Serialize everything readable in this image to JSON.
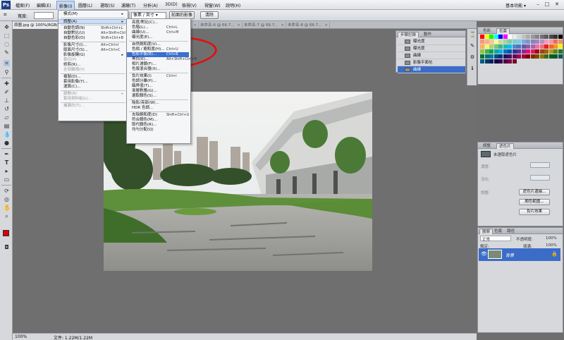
{
  "menubar": {
    "logo": "Ps",
    "items": [
      "檔案(F)",
      "編輯(E)",
      "影像(I)",
      "圖層(L)",
      "選取(S)",
      "濾鏡(T)",
      "分析(A)",
      "3D(D)",
      "檢視(V)",
      "視窗(W)",
      "說明(H)"
    ],
    "workspace": "基本功能 ▾",
    "minimize": "–",
    "restore": "□",
    "close": "✕"
  },
  "options": {
    "width_label": "寬度:",
    "width_value": "",
    "mode_select": "像素 / 英寸 ▾",
    "front_image_button": "前面的影像",
    "clear_button": "清除"
  },
  "tabs": [
    {
      "label": "原圖.jpg @ 100%(RGB/8)",
      "active": true
    },
    {
      "label": "未命名-3 @ 66.7...",
      "active": false
    },
    {
      "label": "未命名-5 @ 66.7...",
      "active": false
    },
    {
      "label": "未命名-4 @ 66.7...",
      "active": false
    },
    {
      "label": "未命名-6 @ 66.7...",
      "active": false
    },
    {
      "label": "未命名-7 @ 66.7...",
      "active": false
    },
    {
      "label": "未命名-8 @ 66.7...",
      "active": false
    }
  ],
  "image_menu": [
    {
      "label": "模式(M)",
      "arrow": "▸"
    },
    {
      "sep": true
    },
    {
      "label": "調整(A)",
      "arrow": "▸",
      "state": "sub"
    },
    {
      "sep": true
    },
    {
      "label": "自動色調(N)",
      "shortcut": "Shift+Ctrl+L"
    },
    {
      "label": "自動對比(U)",
      "shortcut": "Alt+Shift+Ctrl+L"
    },
    {
      "label": "自動色彩(O)",
      "shortcut": "Shift+Ctrl+B"
    },
    {
      "sep": true
    },
    {
      "label": "影像尺寸(I)...",
      "shortcut": "Alt+Ctrl+I"
    },
    {
      "label": "版面尺寸(S)...",
      "shortcut": "Alt+Ctrl+C"
    },
    {
      "label": "影像旋轉(G)",
      "arrow": "▸"
    },
    {
      "label": "裁切(P)",
      "state": "dis"
    },
    {
      "label": "修剪(R)..."
    },
    {
      "label": "全部顯現(V)",
      "state": "dis"
    },
    {
      "sep": true
    },
    {
      "label": "複製(D)..."
    },
    {
      "label": "套用影像(Y)..."
    },
    {
      "label": "運算(C)..."
    },
    {
      "sep": true
    },
    {
      "label": "變數(B)",
      "arrow": "▸",
      "state": "dis"
    },
    {
      "label": "套用資料組(L)...",
      "state": "dis"
    },
    {
      "sep": true
    },
    {
      "label": "補漏白(T)...",
      "state": "dis"
    }
  ],
  "adjust_menu": [
    {
      "label": "亮度/對比(C)..."
    },
    {
      "label": "色階(L)...",
      "shortcut": "Ctrl+L"
    },
    {
      "label": "曲線(U)...",
      "shortcut": "Ctrl+M"
    },
    {
      "label": "曝光度(E)..."
    },
    {
      "sep": true
    },
    {
      "label": "自然飽和度(V)..."
    },
    {
      "label": "色相 / 飽和度(H)...",
      "shortcut": "Ctrl+U"
    },
    {
      "label": "色彩平衡(B)...",
      "shortcut": "Ctrl+B",
      "state": "hl"
    },
    {
      "label": "黑白(K)...",
      "shortcut": "Alt+Shift+Ctrl+B"
    },
    {
      "label": "相片濾鏡(F)..."
    },
    {
      "label": "色版混合器(X)..."
    },
    {
      "sep": true
    },
    {
      "label": "負片效果(I)",
      "shortcut": "Ctrl+I"
    },
    {
      "label": "色調分離(P)..."
    },
    {
      "label": "臨界值(T)..."
    },
    {
      "label": "漸層對應(G)..."
    },
    {
      "label": "選取顏色(S)..."
    },
    {
      "sep": true
    },
    {
      "label": "陰影/亮部(W)..."
    },
    {
      "label": "HDR 色調..."
    },
    {
      "sep": true
    },
    {
      "label": "去除飽和度(D)",
      "shortcut": "Shift+Ctrl+U"
    },
    {
      "label": "符合顏色(M)..."
    },
    {
      "label": "取代顏色(R)..."
    },
    {
      "label": "均勻分配(Q)"
    }
  ],
  "history": {
    "tabs": [
      "步驟記錄",
      "動作"
    ],
    "items": [
      {
        "label": "曝光度",
        "selected": false
      },
      {
        "label": "曝光度",
        "selected": false
      },
      {
        "label": "曲線",
        "selected": false
      },
      {
        "label": "影像平面化",
        "selected": false
      },
      {
        "label": "曲線",
        "selected": true
      }
    ]
  },
  "color_panel": {
    "tabs": [
      "色彩",
      "色票"
    ],
    "swatch_colors": [
      "#ff0000",
      "#ffff00",
      "#00ff00",
      "#00ffff",
      "#0000ff",
      "#ff00ff",
      "#ffffff",
      "#ebebeb",
      "#d6d6d6",
      "#c2c2c2",
      "#adadad",
      "#999999",
      "#858585",
      "#707070",
      "#5c5c5c",
      "#474747",
      "#333333",
      "#000000",
      "#f7977a",
      "#fbad82",
      "#fdc68c",
      "#fff799",
      "#c6df9c",
      "#a4d49d",
      "#81ca9d",
      "#7bcdc8",
      "#6ecff6",
      "#7ea7d8",
      "#8493ca",
      "#8882be",
      "#a286bd",
      "#bc8cbf",
      "#f49bc1",
      "#f5999d",
      "#f26c4f",
      "#f68e56",
      "#fbaf5a",
      "#fff467",
      "#acd372",
      "#7cc576",
      "#3bb878",
      "#1abbb4",
      "#00bff3",
      "#438ccb",
      "#5574b9",
      "#605ca9",
      "#855fa8",
      "#a763a9",
      "#ef6ea8",
      "#f16d7e",
      "#ed1c24",
      "#f26522",
      "#f7941d",
      "#fff200",
      "#8dc63f",
      "#39b54a",
      "#00a651",
      "#00a99d",
      "#00aeef",
      "#0072bc",
      "#0054a6",
      "#2e3192",
      "#662d91",
      "#92278f",
      "#ec008c",
      "#ed145b",
      "#9e0b0f",
      "#a0410d",
      "#a3620a",
      "#aba000",
      "#598527",
      "#1a7b30",
      "#007236",
      "#00746b",
      "#0076a3",
      "#004b80",
      "#003471",
      "#1b1464",
      "#440e62",
      "#630460",
      "#9e005d",
      "#9e0039",
      "#790000",
      "#7b2e00",
      "#7d4900",
      "#827b00",
      "#406618",
      "#005e20",
      "#005826",
      "#005952",
      "#005b7f",
      "#003663",
      "#002157",
      "#0d004c",
      "#32004b",
      "#4b0049",
      "#7b0046",
      "#7a0026"
    ]
  },
  "adjust_panel": {
    "tabs": [
      "調整",
      "遮色片"
    ],
    "label": "未選取遮色片",
    "density_label": "濃度:",
    "feather_label": "羽化:",
    "refine_label": "調整:",
    "edge_button": "遮色片邊緣...",
    "color_range_button": "顏色範圍...",
    "invert_button": "負片效果"
  },
  "layers_panel": {
    "tabs": [
      "圖層",
      "色版",
      "路徑"
    ],
    "mode": "正常",
    "opacity_label": "不透明度:",
    "opacity_value": "100%",
    "lock_label": "鎖定:",
    "fill_label": "填滿:",
    "fill_value": "100%",
    "layer_name": "背景"
  },
  "status": {
    "zoom": "100%",
    "doc": "文件: 1.22M/1.22M"
  },
  "colors": {
    "foreground": "#d40000",
    "background": "#ffffff",
    "annotation": "#e01010"
  }
}
